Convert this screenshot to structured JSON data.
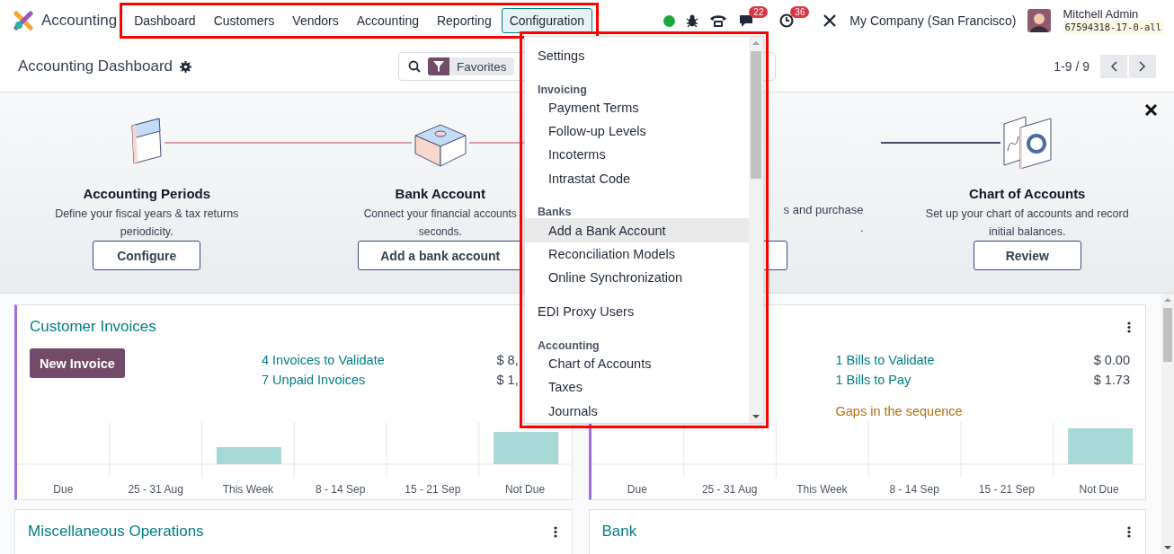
{
  "navbar": {
    "app_name": "Accounting",
    "highlighted": true,
    "menu": [
      {
        "label": "Dashboard",
        "selected": false
      },
      {
        "label": "Customers",
        "selected": false
      },
      {
        "label": "Vendors",
        "selected": false
      },
      {
        "label": "Accounting",
        "selected": false
      },
      {
        "label": "Reporting",
        "selected": false
      },
      {
        "label": "Configuration",
        "selected": true
      }
    ],
    "chat_count": "22",
    "activity_count": "36",
    "company": "My Company (San Francisco)",
    "user_name": "Mitchell Admin",
    "database": "67594318-17-0-all"
  },
  "control_panel": {
    "title": "Accounting Dashboard",
    "search": {
      "facet": "Favorites"
    },
    "pager": "1-9 / 9"
  },
  "onboarding": {
    "steps": [
      {
        "kind": "full",
        "title": "Accounting Periods",
        "description": "Define your fiscal years & tax returns periodicity.",
        "button": "Configure"
      },
      {
        "kind": "full",
        "title": "Bank Account",
        "description_lines": [
          "Connect your financial accounts",
          "seconds."
        ],
        "button": "Add a bank account"
      },
      {
        "kind": "covered",
        "description_lines": [
          "s and purchase",
          "."
        ]
      },
      {
        "kind": "full",
        "title": "Chart of Accounts",
        "description": "Set up your chart of accounts and record initial balances.",
        "button": "Review"
      }
    ]
  },
  "dropdown": {
    "highlighted": true,
    "items": [
      {
        "kind": "item",
        "label": "Settings",
        "selected": false
      },
      {
        "kind": "section",
        "label": "Invoicing"
      },
      {
        "kind": "subitem",
        "label": "Payment Terms",
        "selected": false
      },
      {
        "kind": "subitem",
        "label": "Follow-up Levels",
        "selected": false
      },
      {
        "kind": "subitem",
        "label": "Incoterms",
        "selected": false
      },
      {
        "kind": "subitem",
        "label": "Intrastat Code",
        "selected": false
      },
      {
        "kind": "section",
        "label": "Banks"
      },
      {
        "kind": "subitem",
        "label": "Add a Bank Account",
        "selected": true
      },
      {
        "kind": "subitem",
        "label": "Reconciliation Models",
        "selected": false
      },
      {
        "kind": "subitem",
        "label": "Online Synchronization",
        "selected": false
      },
      {
        "kind": "item",
        "label": "EDI Proxy Users",
        "selected": false
      },
      {
        "kind": "section",
        "label": "Accounting"
      },
      {
        "kind": "subitem",
        "label": "Chart of Accounts",
        "selected": false
      },
      {
        "kind": "subitem",
        "label": "Taxes",
        "selected": false
      },
      {
        "kind": "subitem",
        "label": "Journals",
        "selected": false
      }
    ]
  },
  "cards": [
    {
      "kind": "sales",
      "title": "Customer Invoices",
      "accent": true,
      "button": "New Invoice",
      "links": [
        {
          "label": "4 Invoices to Validate",
          "amount": "$ 8,"
        },
        {
          "label": "7 Unpaid Invoices",
          "amount": "$ 1,"
        }
      ],
      "chart_labels": [
        "Due",
        "25 - 31 Aug",
        "This Week",
        "8 - 14 Sep",
        "15 - 21 Sep",
        "Not Due"
      ]
    },
    {
      "kind": "purchase",
      "accent": true,
      "links": [
        {
          "label": "1 Bills to Validate",
          "amount": "$ 0.00"
        },
        {
          "label": "1 Bills to Pay",
          "amount": "$ 1.73"
        }
      ],
      "warning": "Gaps in the sequence",
      "chart_labels": [
        "Due",
        "25 - 31 Aug",
        "This Week",
        "8 - 14 Sep",
        "15 - 21 Sep",
        "Not Due"
      ]
    },
    {
      "kind": "general",
      "title": "Miscellaneous Operations",
      "accent": false
    },
    {
      "kind": "bank",
      "title": "Bank",
      "accent": false
    }
  ]
}
